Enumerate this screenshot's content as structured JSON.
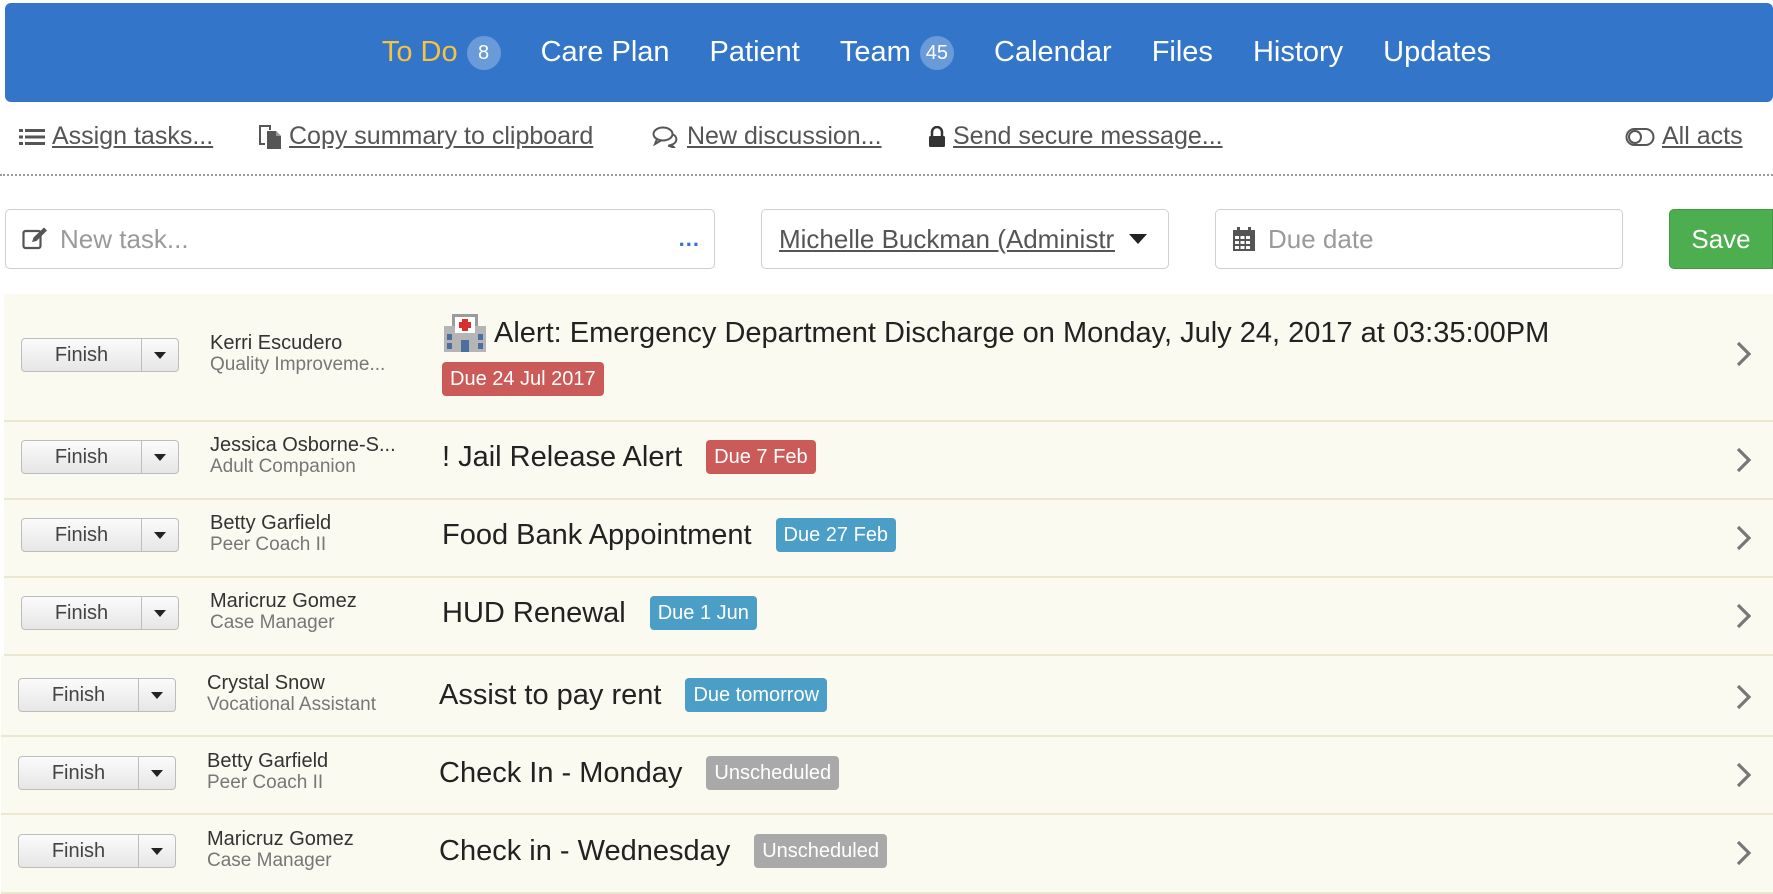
{
  "nav": {
    "tabs": [
      {
        "label": "To Do",
        "badge": "8"
      },
      {
        "label": "Care Plan"
      },
      {
        "label": "Patient"
      },
      {
        "label": "Team",
        "badge": "45"
      },
      {
        "label": "Calendar"
      },
      {
        "label": "Files"
      },
      {
        "label": "History"
      },
      {
        "label": "Updates"
      }
    ],
    "active_color": "#f6c244",
    "bar_color": "#3375c8"
  },
  "actions": {
    "assign": "Assign tasks...",
    "copy": "Copy summary to clipboard",
    "discussion": "New discussion...",
    "secure": "Send secure message...",
    "all": "All acts"
  },
  "new_task": {
    "placeholder": "New task...",
    "more": "...",
    "assignee": "Michelle Buckman (Administrator)",
    "due_placeholder": "Due date",
    "save_label": "Save"
  },
  "tasks": [
    {
      "finish": "Finish",
      "name": "Kerri Escudero",
      "role": "Quality Improveme...",
      "title": "Alert: Emergency Department Discharge on Monday, July 24, 2017 at 03:35:00PM",
      "badge": "Due 24 Jul 2017",
      "badge_color": "red"
    },
    {
      "finish": "Finish",
      "name": "Jessica Osborne-S...",
      "role": "Adult Companion",
      "title": "! Jail Release Alert",
      "badge": "Due 7 Feb",
      "badge_color": "red"
    },
    {
      "finish": "Finish",
      "name": "Betty Garfield",
      "role": "Peer Coach II",
      "title": "Food Bank Appointment",
      "badge": "Due 27 Feb",
      "badge_color": "blue"
    },
    {
      "finish": "Finish",
      "name": "Maricruz Gomez",
      "role": "Case Manager",
      "title": "HUD Renewal",
      "badge": "Due 1 Jun",
      "badge_color": "blue"
    },
    {
      "finish": "Finish",
      "name": "Crystal Snow",
      "role": "Vocational Assistant",
      "title": "Assist to pay rent",
      "badge": "Due tomorrow",
      "badge_color": "blue"
    },
    {
      "finish": "Finish",
      "name": "Betty Garfield",
      "role": "Peer Coach II",
      "title": "Check In - Monday",
      "badge": "Unscheduled",
      "badge_color": "gray"
    },
    {
      "finish": "Finish",
      "name": "Maricruz Gomez",
      "role": "Case Manager",
      "title": "Check in - Wednesday",
      "badge": "Unscheduled",
      "badge_color": "gray"
    }
  ]
}
